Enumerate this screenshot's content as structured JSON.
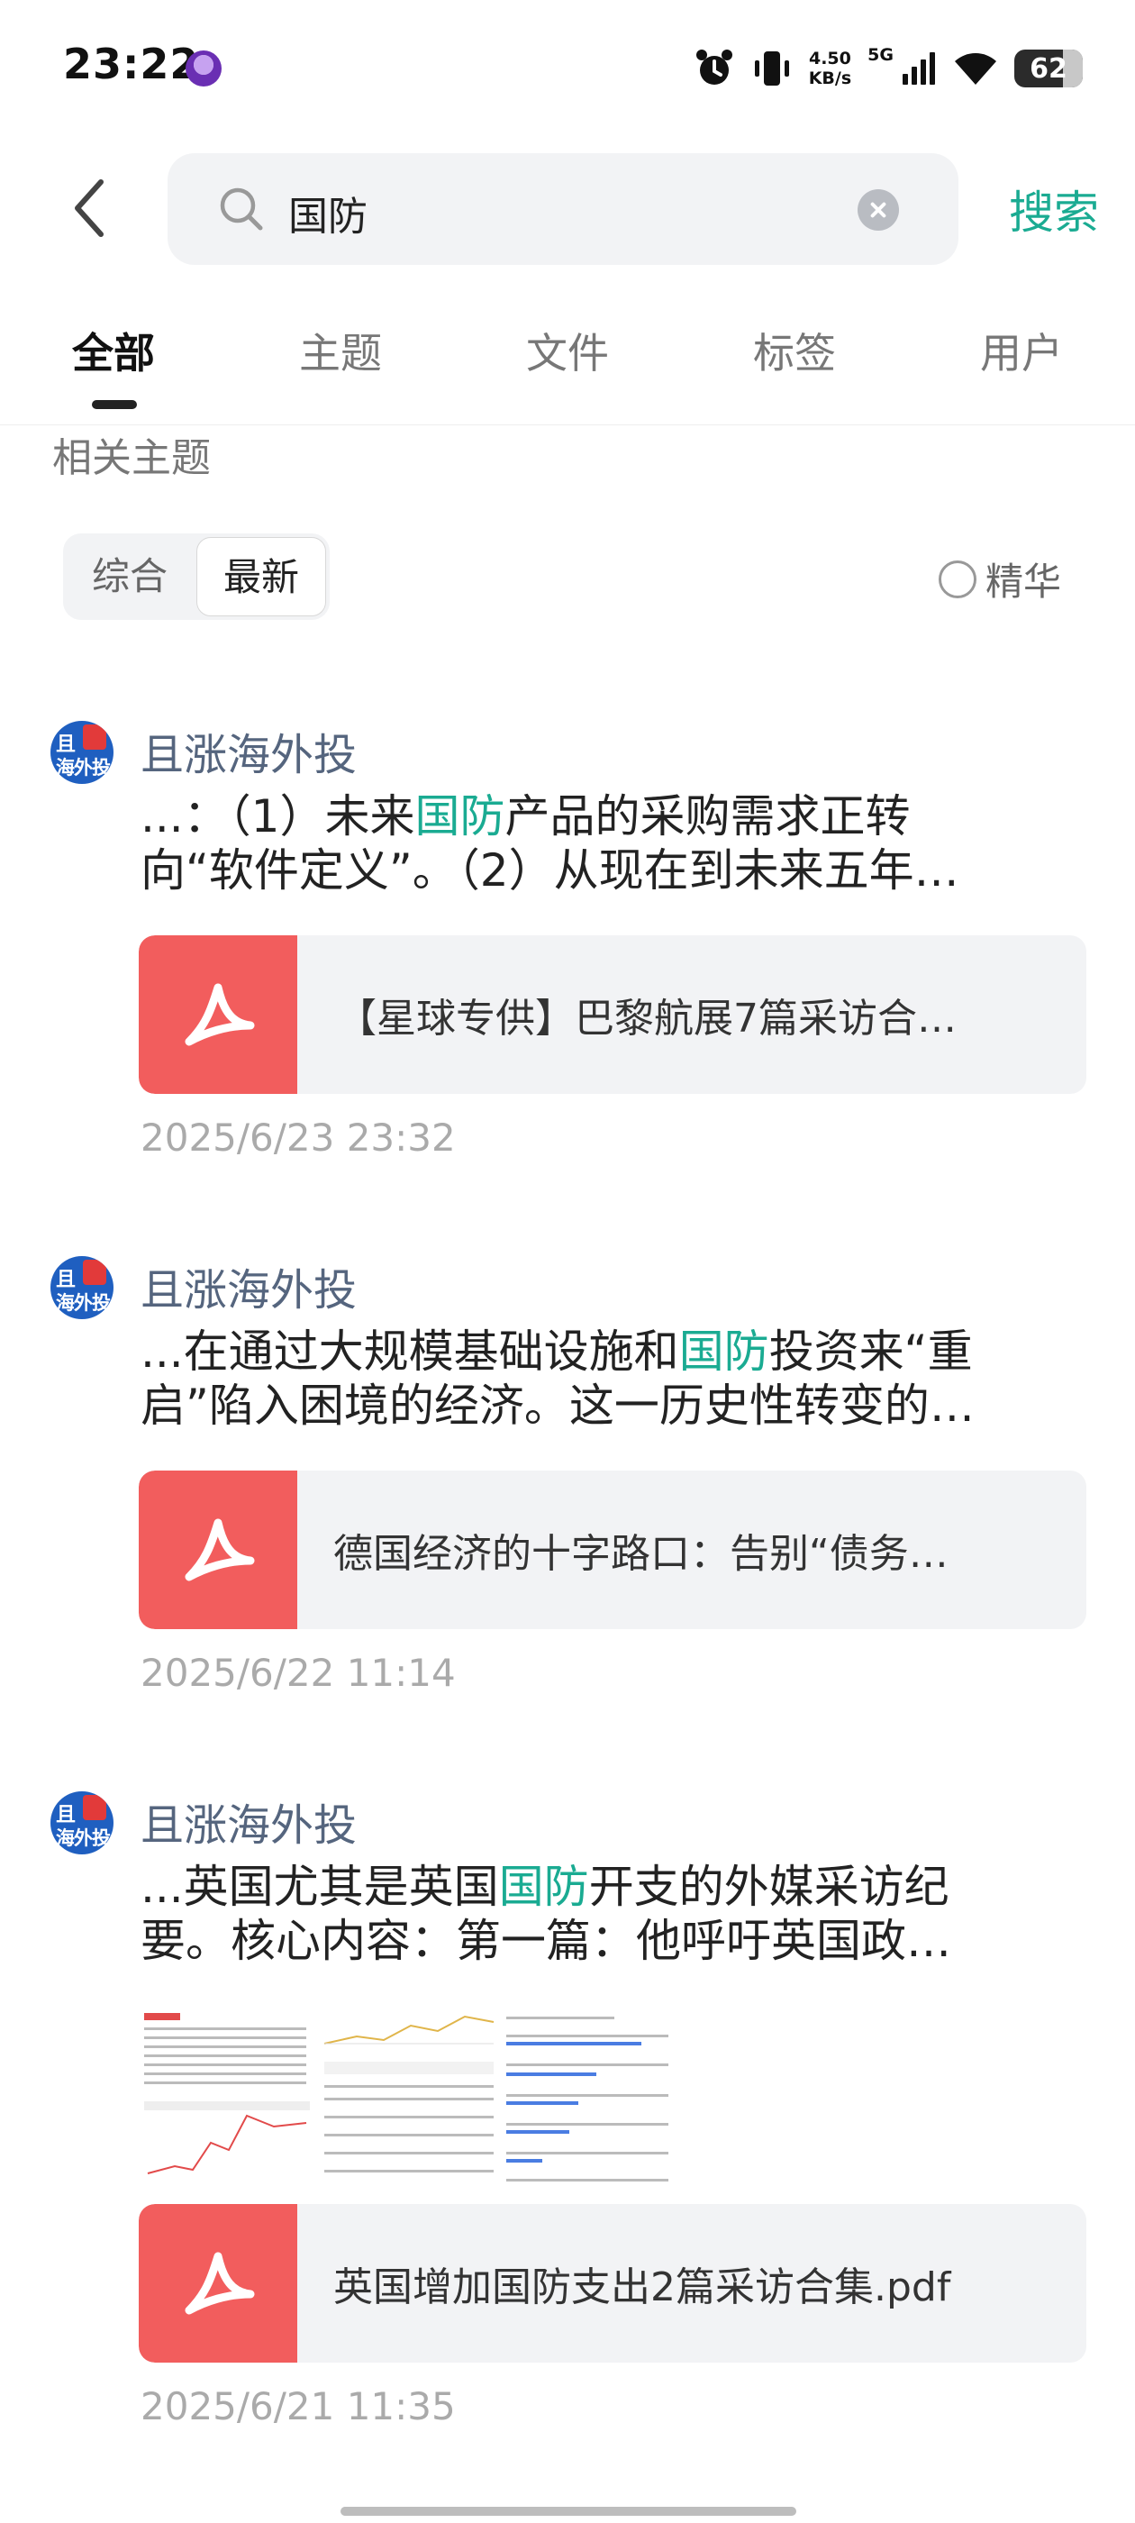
{
  "status_bar": {
    "time": "23:22",
    "net_speed_value": "4.50",
    "net_speed_unit": "KB/s",
    "network": "5G",
    "battery": "62",
    "icons": [
      "alarm-icon",
      "vibrate-icon",
      "signal-icon",
      "wifi-icon",
      "battery-icon"
    ]
  },
  "search": {
    "query": "国防",
    "submit_label": "搜索"
  },
  "tabs": [
    {
      "label": "全部",
      "active": true
    },
    {
      "label": "主题",
      "active": false
    },
    {
      "label": "文件",
      "active": false
    },
    {
      "label": "标签",
      "active": false
    },
    {
      "label": "用户",
      "active": false
    }
  ],
  "section_title": "相关主题",
  "sort": {
    "options": [
      "综合",
      "最新"
    ],
    "selected": "最新",
    "filter_label": "精华",
    "filter_checked": false
  },
  "posts": [
    {
      "author": "且涨海外投",
      "excerpt_line1_pre": "...：（1）未来",
      "excerpt_line1_hl": "国防",
      "excerpt_line1_post": "产品的采购需求正转",
      "excerpt_line2": "向“软件定义”。（2）从现在到未来五年…",
      "file_name": "【星球专供】巴黎航展7篇采访合…",
      "date": "2025/6/23 23:32"
    },
    {
      "author": "且涨海外投",
      "excerpt_line1_pre": "...在通过大规模基础设施和",
      "excerpt_line1_hl": "国防",
      "excerpt_line1_post": "投资来“重",
      "excerpt_line2": "启”陷入困境的经济。这一历史性转变的…",
      "file_name": "德国经济的十字路口：告别“债务…",
      "date": "2025/6/22 11:14"
    },
    {
      "author": "且涨海外投",
      "excerpt_line1_pre": "...英国尤其是英国",
      "excerpt_line1_hl": "国防",
      "excerpt_line1_post": "开支的外媒采访纪",
      "excerpt_line2": "要。核心内容：第一篇：他呼吁英国政…",
      "file_name": "英国增加国防支出2篇采访合集.pdf",
      "date": "2025/6/21 11:35"
    }
  ],
  "colors": {
    "accent": "#1aab92",
    "author": "#55657e",
    "pdf_icon_bg": "#f25d5d"
  }
}
